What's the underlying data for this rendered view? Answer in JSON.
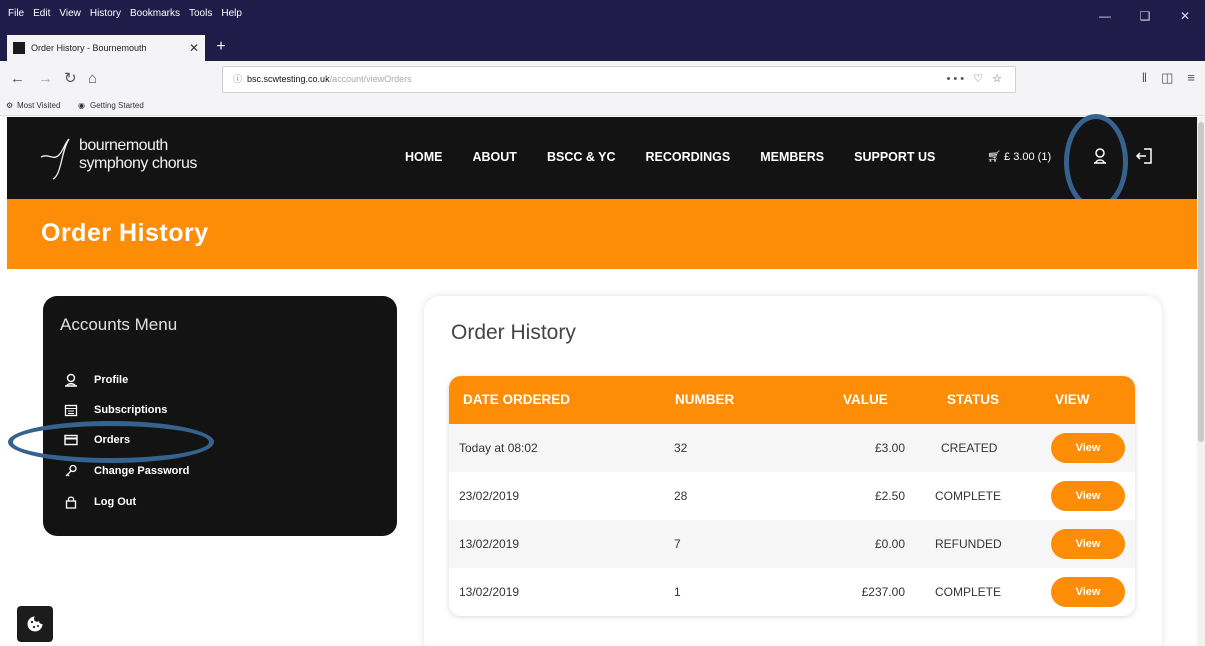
{
  "browser": {
    "menu": [
      "File",
      "Edit",
      "View",
      "History",
      "Bookmarks",
      "Tools",
      "Help"
    ],
    "tab_title": "Order History - Bournemouth",
    "url_host": "bsc.scwtesting.co.uk",
    "url_path": "/account/viewOrders",
    "url_more": "•••",
    "bookmarks": [
      "Most Visited",
      "Getting Started"
    ]
  },
  "site": {
    "logo_line1": "bournemouth",
    "logo_line2": "symphony chorus",
    "nav": [
      "HOME",
      "ABOUT",
      "BSCC & YC",
      "RECORDINGS",
      "MEMBERS",
      "SUPPORT US"
    ],
    "cart": "£ 3.00 (1)",
    "banner_title": "Order History"
  },
  "accounts_menu": {
    "title": "Accounts Menu",
    "items": [
      {
        "label": "Profile",
        "icon": "user-icon"
      },
      {
        "label": "Subscriptions",
        "icon": "calendar-icon"
      },
      {
        "label": "Orders",
        "icon": "card-icon"
      },
      {
        "label": "Change Password",
        "icon": "key-icon"
      },
      {
        "label": "Log Out",
        "icon": "lock-icon"
      }
    ]
  },
  "orders": {
    "title": "Order History",
    "columns": [
      "DATE ORDERED",
      "NUMBER",
      "VALUE",
      "STATUS",
      "VIEW"
    ],
    "rows": [
      {
        "date": "Today at 08:02",
        "number": "32",
        "value": "£3.00",
        "status": "CREATED",
        "action": "View"
      },
      {
        "date": "23/02/2019",
        "number": "28",
        "value": "£2.50",
        "status": "COMPLETE",
        "action": "View"
      },
      {
        "date": "13/02/2019",
        "number": "7",
        "value": "£0.00",
        "status": "REFUNDED",
        "action": "View"
      },
      {
        "date": "13/02/2019",
        "number": "1",
        "value": "£237.00",
        "status": "COMPLETE",
        "action": "View"
      }
    ]
  },
  "colors": {
    "accent": "#fd8c06",
    "dark": "#131313",
    "highlight": "#36628e"
  }
}
